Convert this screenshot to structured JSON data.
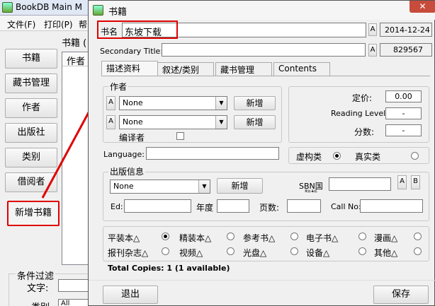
{
  "bg_window": {
    "title": "BookDB Main M",
    "menu": [
      "文件(F)",
      "打印(P)",
      "帮"
    ],
    "nav": [
      "书籍",
      "藏书管理",
      "作者",
      "出版社",
      "类别",
      "借阅者",
      "新增书籍"
    ],
    "selected_nav": "新增书籍",
    "list_title": "书籍 (",
    "list_column": "作者",
    "filter_group": "条件过滤",
    "filter_text_label": "文字:",
    "category_label": "类别",
    "category_value": "All"
  },
  "dialog": {
    "title": "书籍",
    "close_symbol": "✕",
    "book_name_label": "书名",
    "book_name_value": "东坡下载",
    "date_value": "2014-12-24",
    "secondary_title_label": "Secondary Title:",
    "secondary_title_value": "",
    "id_value": "829567",
    "a_button": "A",
    "b_button": "B",
    "tabs": [
      "描述资料",
      "叙述/类别",
      "藏书管理",
      "Contents"
    ],
    "active_tab": "描述资料",
    "authors": {
      "group_label": "作者",
      "rows": [
        {
          "value": "None",
          "add_label": "新增"
        },
        {
          "value": "None",
          "add_label": "新增"
        }
      ],
      "editor_label": "编译者"
    },
    "pricing": {
      "price_label": "定价:",
      "price_value": "0.00",
      "reading_level_label": "Reading Level",
      "reading_level_value": "-",
      "score_label": "分数:",
      "score_value": "-"
    },
    "language_label": "Language:",
    "language_value": "",
    "fiction_label": "虚构类",
    "fact_label": "真实类",
    "fiction_selected": true,
    "publishing": {
      "group_label": "出版信息",
      "publisher_value": "None",
      "add_label": "新增",
      "isbn_label": "SBN国",
      "isbn_label_2": "际标",
      "isbn_value": "",
      "edition_label": "Ed:",
      "edition_value": "",
      "year_label": "年度",
      "year_value": "",
      "pages_label": "页数:",
      "pages_value": "",
      "call_no_label": "Call No:",
      "call_no_value": ""
    },
    "formats": [
      {
        "label": "平装本△",
        "selected": true
      },
      {
        "label": "精装本△",
        "selected": false
      },
      {
        "label": "参考书△",
        "selected": false
      },
      {
        "label": "电子书△",
        "selected": false
      },
      {
        "label": "漫画△",
        "selected": false
      },
      {
        "label": "报刊杂志△",
        "selected": false
      },
      {
        "label": "视频△",
        "selected": false
      },
      {
        "label": "光盘△",
        "selected": false
      },
      {
        "label": "设备△",
        "selected": false
      },
      {
        "label": "其他△",
        "selected": false
      }
    ],
    "total_copies": "Total Copies: 1  (1 available)",
    "exit_label": "退出",
    "save_label": "保存"
  },
  "colors": {
    "highlight": "#e00000",
    "dialog_bg": "#f0f0f0"
  }
}
